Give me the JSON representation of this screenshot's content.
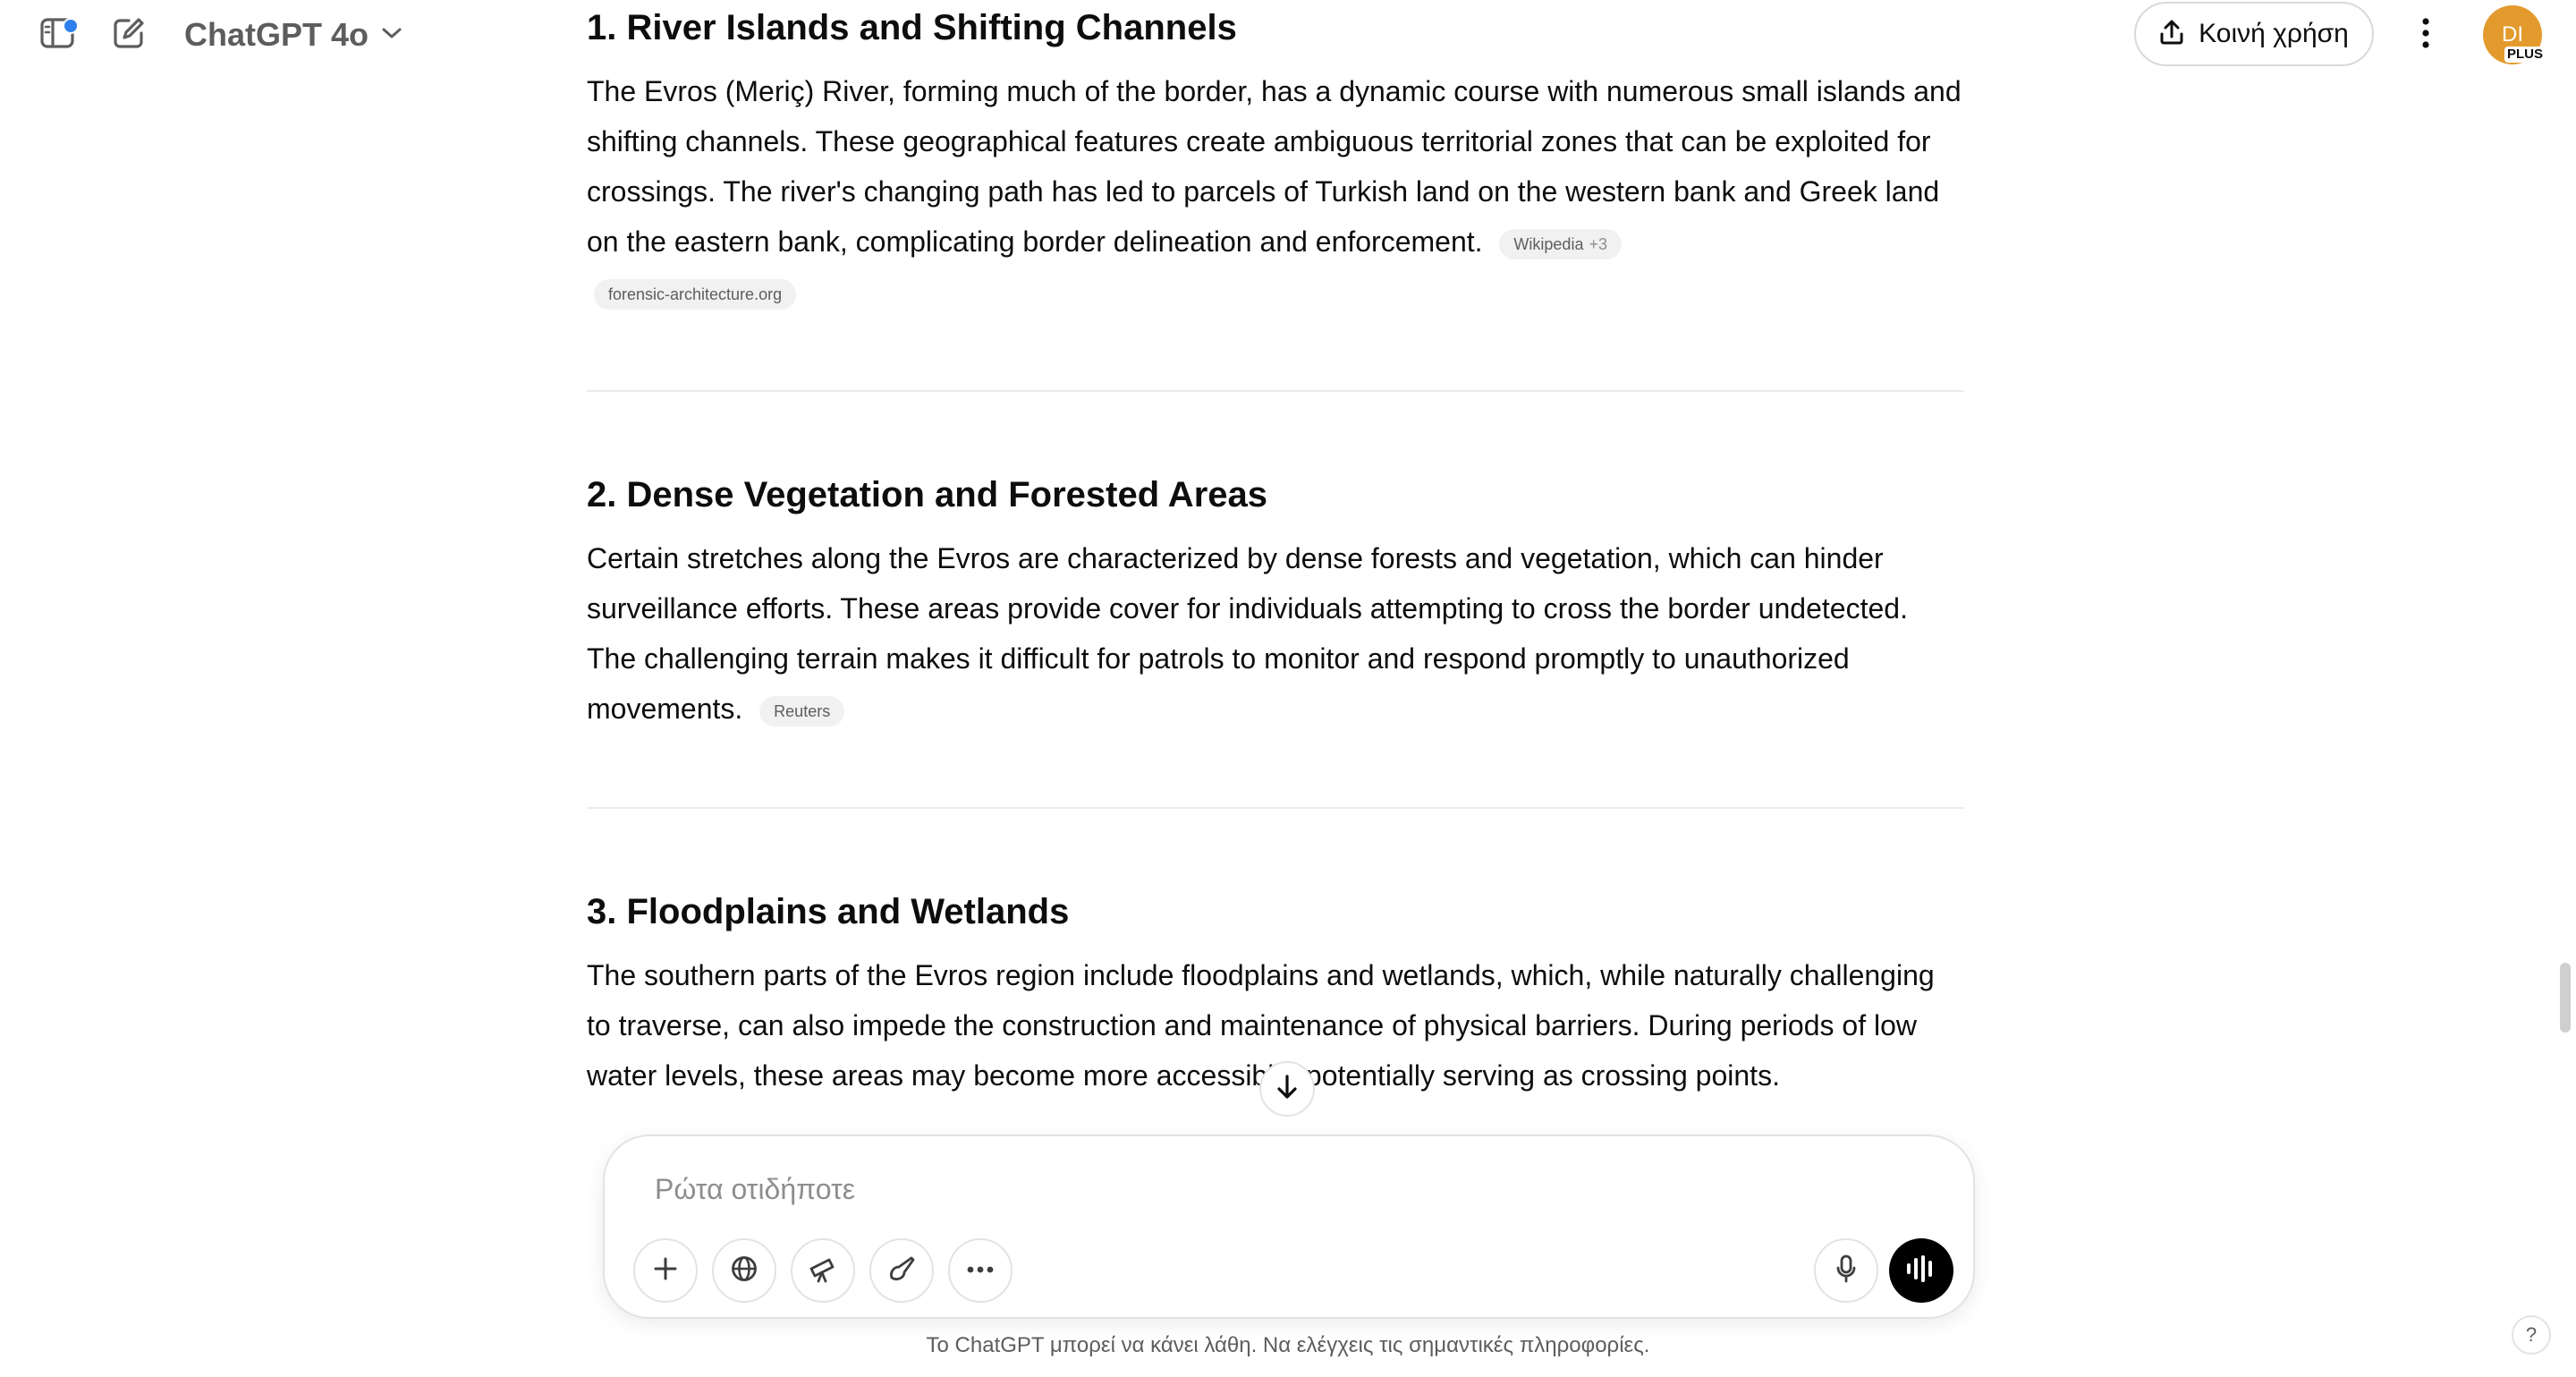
{
  "header": {
    "model_title": "ChatGPT 4o",
    "share_label": "Κοινή χρήση",
    "avatar_initials": "DI",
    "plan_badge": "PLUS"
  },
  "article": {
    "sections": [
      {
        "title": "1. River Islands and Shifting Channels",
        "body": "The Evros (Meriç) River, forming much of the border, has a dynamic course with numerous small islands and shifting channels. These geographical features create ambiguous territorial zones that can be exploited for crossings. The river's changing path has led to parcels of Turkish land on the western bank and Greek land on the eastern bank, complicating border delineation and enforcement.",
        "citations": [
          {
            "label": "Wikipedia",
            "extra": "+3"
          },
          {
            "label": "forensic-architecture.org",
            "extra": ""
          }
        ]
      },
      {
        "title": "2. Dense Vegetation and Forested Areas",
        "body": "Certain stretches along the Evros are characterized by dense forests and vegetation, which can hinder surveillance efforts. These areas provide cover for individuals attempting to cross the border undetected. The challenging terrain makes it difficult for patrols to monitor and respond promptly to unauthorized movements.",
        "citations": [
          {
            "label": "Reuters",
            "extra": ""
          }
        ]
      },
      {
        "title": "3. Floodplains and Wetlands",
        "body": "The southern parts of the Evros region include floodplains and wetlands, which, while naturally challenging to traverse, can also impede the construction and maintenance of physical barriers. During periods of low water levels, these areas may become more accessible, potentially serving as crossing points.",
        "citations": []
      }
    ]
  },
  "composer": {
    "placeholder": "Ρώτα οτιδήποτε"
  },
  "footer": {
    "disclaimer": "Το ChatGPT μπορεί να κάνει λάθη. Να ελέγχεις τις σημαντικές πληροφορίες.",
    "help_label": "?"
  },
  "colors": {
    "accent_dot": "#2f80ed",
    "avatar_bg": "#e39a2d",
    "voice_button_bg": "#000000"
  },
  "icons": {
    "sidebar_toggle": "sidebar-icon",
    "new_chat": "edit-icon",
    "model_dropdown": "chevron-down-icon",
    "share": "upload-icon",
    "more": "vertical-dots-icon",
    "scroll_down": "arrow-down-icon",
    "tools": [
      "plus-icon",
      "globe-icon",
      "telescope-icon",
      "brush-icon",
      "horizontal-dots-icon"
    ],
    "mic": "microphone-icon",
    "voice": "voice-waveform-icon"
  }
}
